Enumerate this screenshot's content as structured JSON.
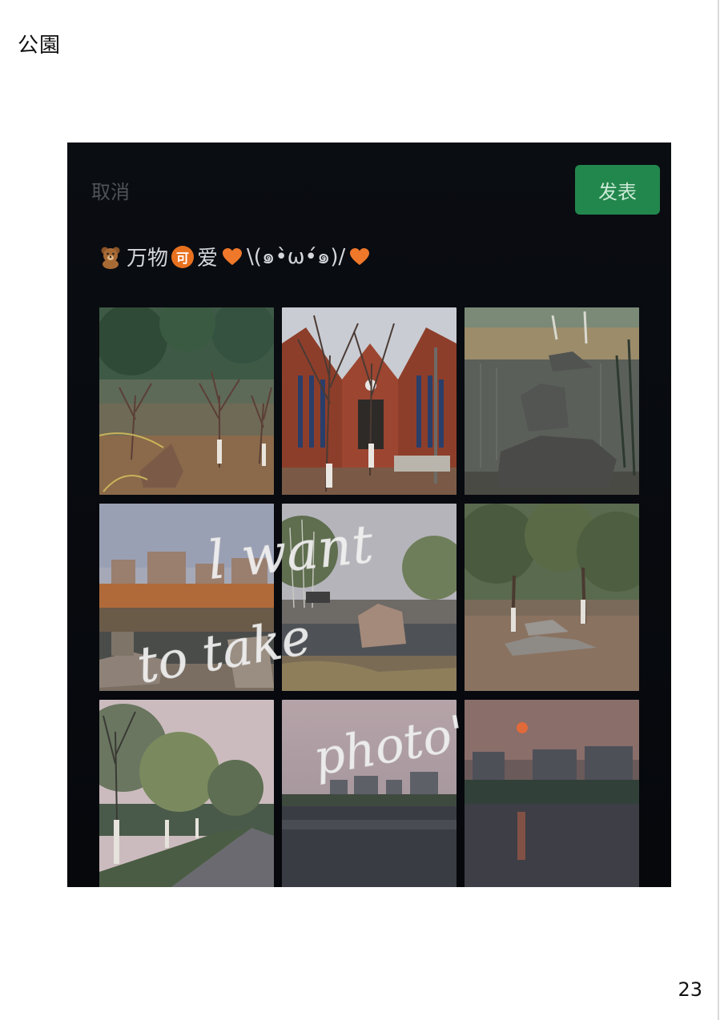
{
  "page": {
    "title": "公園",
    "number": "23"
  },
  "post_screen": {
    "cancel_label": "取消",
    "publish_label": "发表",
    "caption": {
      "segment_1": "万物",
      "badge": "可",
      "segment_2": "爱",
      "kaomoji": "\\(๑•̀ω•́๑)/"
    },
    "emoji_icons": [
      "bear-emoji",
      "ke-badge",
      "orange-heart-emoji",
      "orange-heart-emoji"
    ]
  },
  "overlay_text": {
    "line_1": "l want",
    "line_2": "to take",
    "line_3": "photo'"
  },
  "photos": [
    "park-pine-trees-and-rock",
    "red-brick-pavilion-with-bare-trees",
    "pond-with-scholar-rocks",
    "apartment-buildings-across-pond",
    "willow-and-rock-by-water",
    "pine-trees-and-rocks-on-lawn",
    "willow-lined-path",
    "river-at-dusk",
    "sunset-over-river"
  ],
  "colors": {
    "phone_background": "#07090d",
    "publish_button": "#22874c",
    "cancel_text": "#4f5358",
    "caption_text": "#d4d7dc",
    "heart": "#f0782a"
  }
}
